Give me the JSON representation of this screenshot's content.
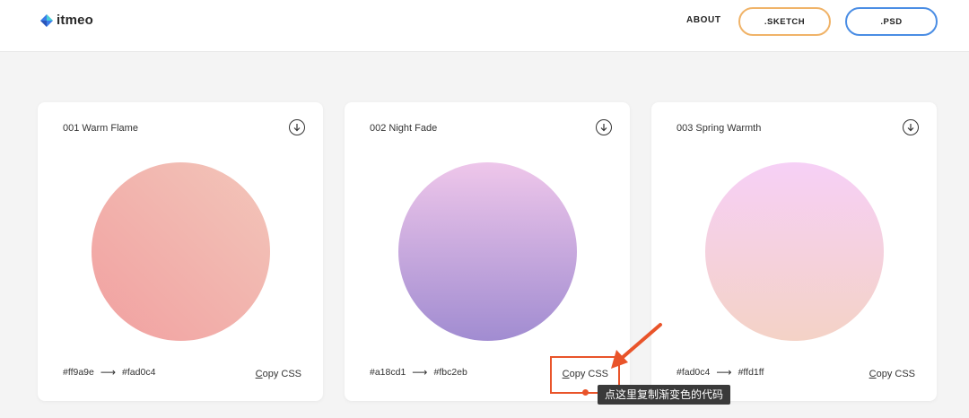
{
  "header": {
    "logo_text": "itmeo",
    "nav_about": "ABOUT",
    "btn_sketch": ".SKETCH",
    "btn_psd": ".PSD"
  },
  "cards": [
    {
      "title": "001 Warm Flame",
      "from": "#ff9a9e",
      "to": "#fad0c4",
      "copy_first": "C",
      "copy_rest": "opy CSS",
      "gradient_colors": [
        "#ff9a9e",
        "#fad0c4"
      ]
    },
    {
      "title": "002 Night Fade",
      "from": "#a18cd1",
      "to": "#fbc2eb",
      "copy_first": "C",
      "copy_rest": "opy CSS",
      "gradient_colors": [
        "#a18cd1",
        "#fbc2eb"
      ]
    },
    {
      "title": "003 Spring Warmth",
      "from": "#fad0c4",
      "to": "#ffd1ff",
      "copy_first": "C",
      "copy_rest": "opy CSS",
      "gradient_colors": [
        "#fad0c4",
        "#ffd1ff"
      ]
    }
  ],
  "arrow_separator": "⟶",
  "annotation": {
    "tooltip_text": "点这里复制渐变色的代码",
    "accent_color": "#e9542a"
  }
}
